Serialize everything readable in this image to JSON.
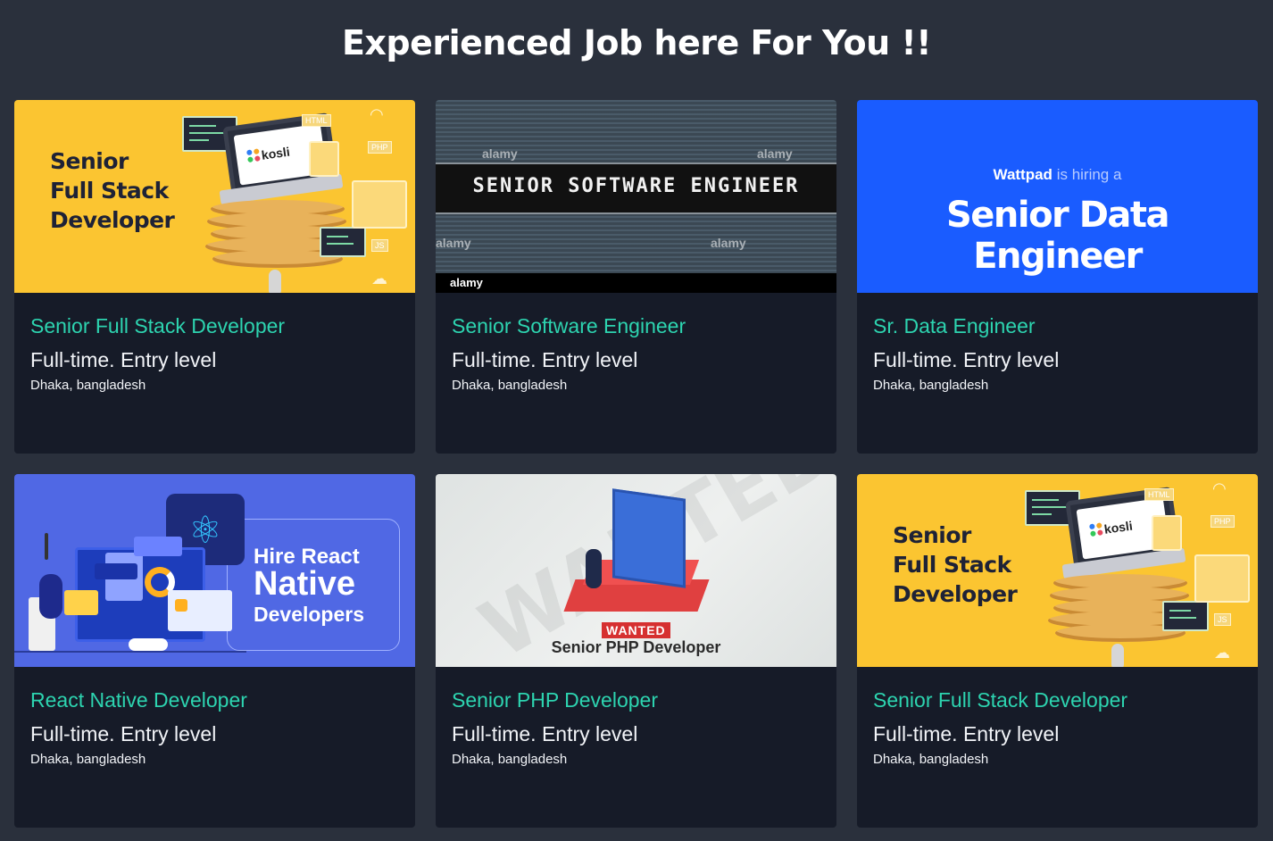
{
  "heading": "Experienced Job here For You !!",
  "jobs": [
    {
      "title": "Senior Full Stack Developer",
      "type": "Full-time. Entry level",
      "location": "Dhaka, bangladesh",
      "image": {
        "kind": "full-stack",
        "lines": [
          "Senior",
          "Full Stack",
          "Developer"
        ],
        "brand": "kosli",
        "tags": [
          "HTML",
          "PHP",
          "JS"
        ]
      }
    },
    {
      "title": "Senior Software Engineer",
      "type": "Full-time. Entry level",
      "location": "Dhaka, bangladesh",
      "image": {
        "kind": "software",
        "banner": "SENIOR SOFTWARE ENGINEER",
        "watermark": "alamy"
      }
    },
    {
      "title": "Sr. Data Engineer",
      "type": "Full-time. Entry level",
      "location": "Dhaka, bangladesh",
      "image": {
        "kind": "data",
        "company": "Wattpad",
        "hiring": "is hiring a",
        "headline": "Senior Data Engineer"
      }
    },
    {
      "title": "React Native Developer",
      "type": "Full-time. Entry level",
      "location": "Dhaka, bangladesh",
      "image": {
        "kind": "react",
        "line1": "Hire React",
        "line2": "Native",
        "line3": "Developers"
      }
    },
    {
      "title": "Senior PHP Developer",
      "type": "Full-time. Entry level",
      "location": "Dhaka, bangladesh",
      "image": {
        "kind": "php",
        "badge": "WANTED",
        "caption": "Senior PHP Developer",
        "bg_word": "WANTED"
      }
    },
    {
      "title": "Senior Full Stack Developer",
      "type": "Full-time. Entry level",
      "location": "Dhaka, bangladesh",
      "image": {
        "kind": "full-stack",
        "lines": [
          "Senior",
          "Full Stack",
          "Developer"
        ],
        "brand": "kosli",
        "tags": [
          "HTML",
          "PHP",
          "JS"
        ]
      }
    }
  ],
  "colors": {
    "page_bg": "#2a303c",
    "card_bg": "#161b28",
    "title_accent": "#2dd4b0"
  }
}
